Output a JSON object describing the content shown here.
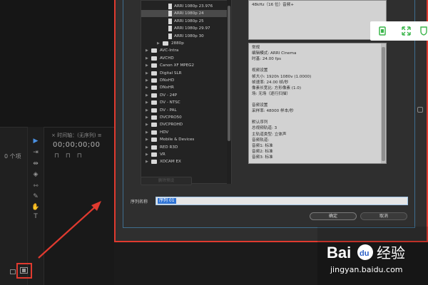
{
  "background_app": {
    "timeline_tab": "× 时间轴：(无序列) ≡",
    "timecode": "00;00;00;00",
    "timeline_icons": "⊓ ⊓ ⊓",
    "left_panel_count": "0 个项"
  },
  "preset_tree": {
    "items": [
      {
        "label": "ARRI 1080p 23.976",
        "type": "file"
      },
      {
        "label": "ARRI 1080p 24",
        "type": "file",
        "selected": true
      },
      {
        "label": "ARRI 1080p 25",
        "type": "file"
      },
      {
        "label": "ARRI 1080p 29.97",
        "type": "file"
      },
      {
        "label": "ARRI 1080p 30",
        "type": "file"
      },
      {
        "label": "2880p",
        "type": "subfolder"
      },
      {
        "label": "AVC-Intra",
        "type": "folder"
      },
      {
        "label": "AVCHD",
        "type": "folder"
      },
      {
        "label": "Canon XF MPEG2",
        "type": "folder"
      },
      {
        "label": "Digital SLR",
        "type": "folder"
      },
      {
        "label": "DNxHD",
        "type": "folder"
      },
      {
        "label": "DNxHR",
        "type": "folder"
      },
      {
        "label": "DV - 24P",
        "type": "folder"
      },
      {
        "label": "DV - NTSC",
        "type": "folder"
      },
      {
        "label": "DV - PAL",
        "type": "folder"
      },
      {
        "label": "DVCPRO50",
        "type": "folder"
      },
      {
        "label": "DVCPROHD",
        "type": "folder"
      },
      {
        "label": "HDV",
        "type": "folder"
      },
      {
        "label": "Mobile & Devices",
        "type": "folder"
      },
      {
        "label": "RED R3D",
        "type": "folder"
      },
      {
        "label": "VR",
        "type": "folder"
      },
      {
        "label": "XDCAM EX",
        "type": "folder"
      }
    ]
  },
  "description_top": {
    "lines": [
      "48kHz（16 位）音频+"
    ]
  },
  "description": {
    "lines": [
      "常规",
      "  编辑模式: ARRI Cinema",
      "  时基: 24.00 fps",
      "",
      "视频设置",
      "  帧大小: 1920h 1080v (1.0000)",
      "  帧速率: 24.00 帧/秒",
      "  像素长宽比: 方形像素 (1.0)",
      "  场: 无场（逐行扫描）",
      "",
      "音频设置",
      "  采样率: 48000 样本/秒",
      "",
      "默认序列",
      "  总视频轨道: 3",
      "  主轨道类型: 立体声",
      "  音频轨道:",
      "  音频1: 标准",
      "  音频2: 标准",
      "  音频3: 标准"
    ]
  },
  "buttons": {
    "delete_preset": "删除预设",
    "ok": "确定",
    "cancel": "取消"
  },
  "sequence_name": {
    "label": "序列名称",
    "value": "序列 01"
  },
  "overlay_toolbar": {
    "icons": [
      "copy-icon",
      "expand-icon",
      "shield-icon"
    ]
  },
  "watermark": {
    "logo_text": "Bai 经验",
    "url": "jingyan.baidu.com"
  },
  "colors": {
    "highlight_red": "#e03a2f",
    "selection_blue": "#2f74d6",
    "overlay_green": "#3ab54a"
  }
}
